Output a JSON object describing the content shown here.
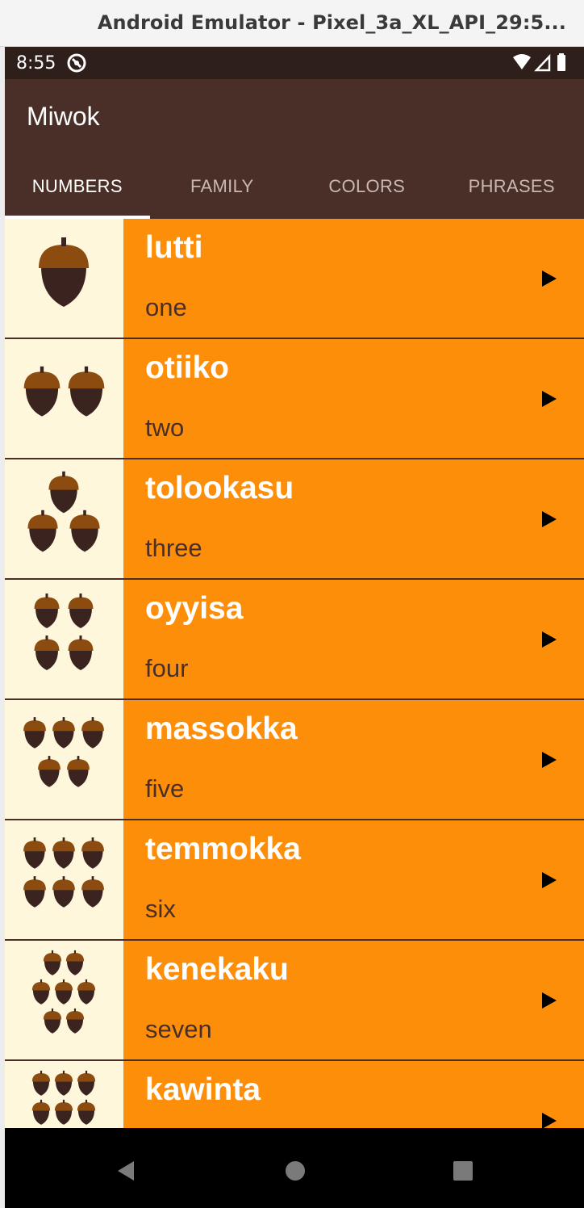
{
  "window": {
    "title": "Android Emulator - Pixel_3a_XL_API_29:5..."
  },
  "status_bar": {
    "time": "8:55"
  },
  "app": {
    "title": "Miwok"
  },
  "tabs": [
    {
      "label": "NUMBERS",
      "active": true
    },
    {
      "label": "FAMILY",
      "active": false
    },
    {
      "label": "COLORS",
      "active": false
    },
    {
      "label": "PHRASES",
      "active": false
    }
  ],
  "rows": [
    {
      "miwok": "lutti",
      "english": "one",
      "acorns": 1
    },
    {
      "miwok": "otiiko",
      "english": "two",
      "acorns": 2
    },
    {
      "miwok": "tolookasu",
      "english": "three",
      "acorns": 3
    },
    {
      "miwok": "oyyisa",
      "english": "four",
      "acorns": 4
    },
    {
      "miwok": "massokka",
      "english": "five",
      "acorns": 5
    },
    {
      "miwok": "temmokka",
      "english": "six",
      "acorns": 6
    },
    {
      "miwok": "kenekaku",
      "english": "seven",
      "acorns": 7
    },
    {
      "miwok": "kawinta",
      "english": "",
      "acorns": 8
    }
  ],
  "icons": {
    "play": "play-icon",
    "nav_back": "back-icon",
    "nav_home": "home-icon",
    "nav_recents": "recents-icon"
  },
  "colors": {
    "status_bar": "#2e1f1b",
    "primary": "#4a2f29",
    "row": "#fd8e09",
    "thumb_bg": "#fef7dc",
    "acorn_cap": "#8c4b0f",
    "acorn_body": "#3b2420"
  }
}
